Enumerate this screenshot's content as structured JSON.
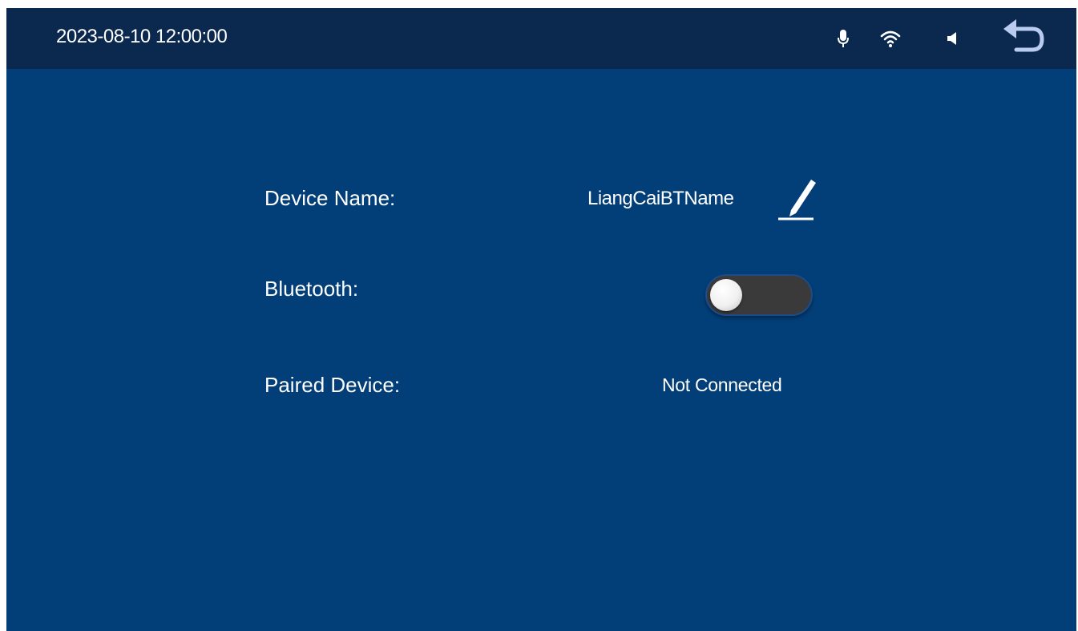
{
  "status_bar": {
    "datetime": "2023-08-10 12:00:00",
    "icons": [
      "mic-icon",
      "wifi-icon",
      "speaker-icon",
      "back-icon"
    ]
  },
  "settings": {
    "device_name_label": "Device Name:",
    "device_name_value": "LiangCaiBTName",
    "bluetooth_label": "Bluetooth:",
    "bluetooth_enabled": false,
    "paired_device_label": "Paired Device:",
    "paired_device_value": "Not Connected"
  },
  "colors": {
    "background": "#023f78",
    "status_bar": "#0b284f",
    "text": "#ffffff",
    "toggle_off": "#3a3a3a"
  }
}
